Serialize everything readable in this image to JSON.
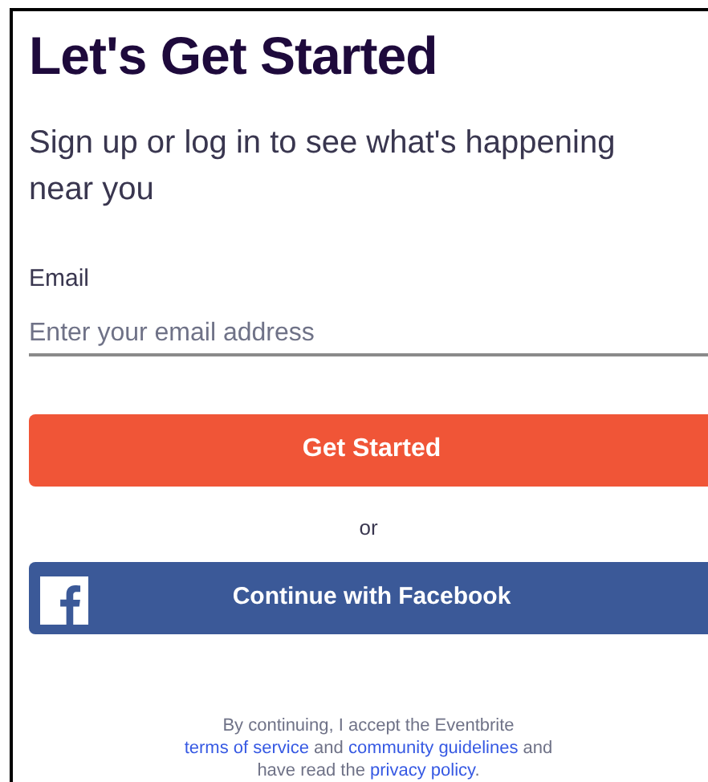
{
  "title": "Let's Get Started",
  "subtitle": "Sign up or log in to see what's happening near you",
  "email_field": {
    "label": "Email",
    "placeholder": "Enter your email address"
  },
  "primary_button": "Get Started",
  "separator": "or",
  "facebook_button": "Continue with Facebook",
  "legal": [
    [
      {
        "kind": "text",
        "text": "By continuing, I accept the Eventbrite"
      }
    ],
    [
      {
        "kind": "link",
        "text": "terms of service"
      },
      {
        "kind": "text",
        "text": " and "
      },
      {
        "kind": "link",
        "text": "community guidelines"
      },
      {
        "kind": "text",
        "text": " and"
      }
    ],
    [
      {
        "kind": "text",
        "text": "have read the "
      },
      {
        "kind": "link",
        "text": "privacy policy"
      },
      {
        "kind": "text",
        "text": "."
      }
    ]
  ]
}
